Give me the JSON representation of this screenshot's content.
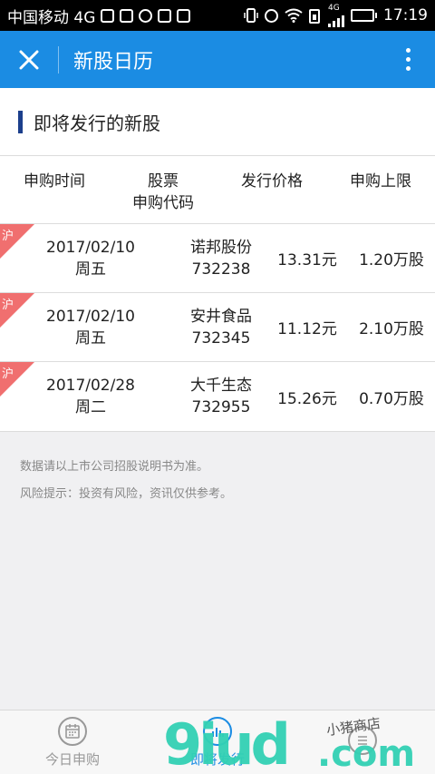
{
  "status_bar": {
    "carrier": "中国移动 4G",
    "network_badge": "4G",
    "time": "17:19",
    "battery_level": 0.85,
    "icons": [
      "image-icon",
      "android-icon",
      "sync-icon",
      "android-icon",
      "download-icon",
      "vibrate-icon",
      "alarm-icon",
      "wifi-icon",
      "data-icon",
      "signal-icon",
      "battery-icon"
    ]
  },
  "app_bar": {
    "title": "新股日历",
    "background": "#1b8ce3"
  },
  "section": {
    "title": "即将发行的新股",
    "accent": "#1c3f8c"
  },
  "table": {
    "headers": {
      "date": "申购时间",
      "stock_line1": "股票",
      "stock_line2": "申购代码",
      "price": "发行价格",
      "limit": "申购上限"
    },
    "rows": [
      {
        "market": "沪",
        "date": "2017/02/10",
        "weekday": "周五",
        "name": "诺邦股份",
        "code": "732238",
        "price": "13.31元",
        "limit": "1.20万股"
      },
      {
        "market": "沪",
        "date": "2017/02/10",
        "weekday": "周五",
        "name": "安井食品",
        "code": "732345",
        "price": "11.12元",
        "limit": "2.10万股"
      },
      {
        "market": "沪",
        "date": "2017/02/28",
        "weekday": "周二",
        "name": "大千生态",
        "code": "732955",
        "price": "15.26元",
        "limit": "0.70万股"
      }
    ],
    "tag_color": "#f06f6f"
  },
  "notes": {
    "line1": "数据请以上市公司招股说明书为准。",
    "line2": "风险提示：投资有风险，资讯仅供参考。"
  },
  "bottom_nav": {
    "items": [
      {
        "label": "今日申购",
        "icon": "calendar-icon",
        "active": false
      },
      {
        "label": "即将发行",
        "icon": "chart-icon",
        "active": true
      },
      {
        "label": "",
        "icon": "list-icon",
        "active": false
      }
    ]
  },
  "watermark": {
    "main": "9iud",
    "suffix": ".com",
    "handwriting": "小猪商店"
  }
}
